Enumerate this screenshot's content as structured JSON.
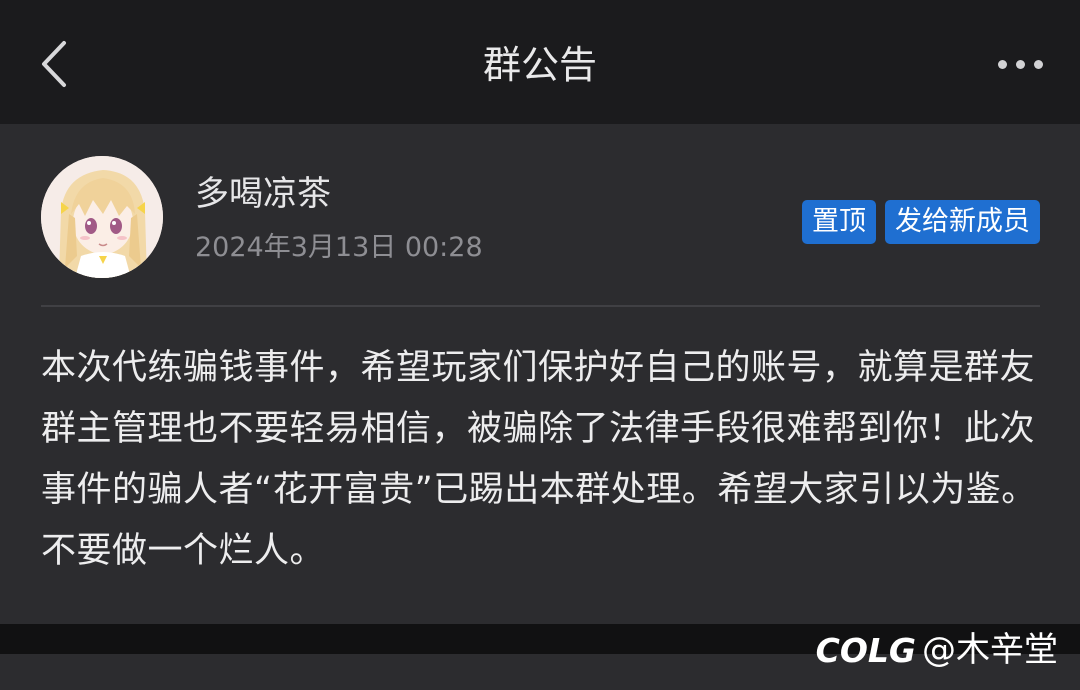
{
  "header": {
    "title": "群公告",
    "back_icon": "chevron-left-icon",
    "more_icon": "more-horizontal-icon"
  },
  "announcement": {
    "author": "多喝凉茶",
    "timestamp": "2024年3月13日 00:28",
    "tags": [
      "置顶",
      "发给新成员"
    ],
    "body": "本次代练骗钱事件，希望玩家们保护好自己的账号，就算是群友群主管理也不要轻易相信，被骗除了法律手段很难帮到你！此次事件的骗人者“花开富贵”已踢出本群处理。希望大家引以为鉴。不要做一个烂人。"
  },
  "watermark": {
    "logo": "COLG",
    "text": "@木辛堂"
  },
  "colors": {
    "background": "#1b1b1d",
    "card": "#2c2c2f",
    "tag": "#1f6fd1"
  }
}
